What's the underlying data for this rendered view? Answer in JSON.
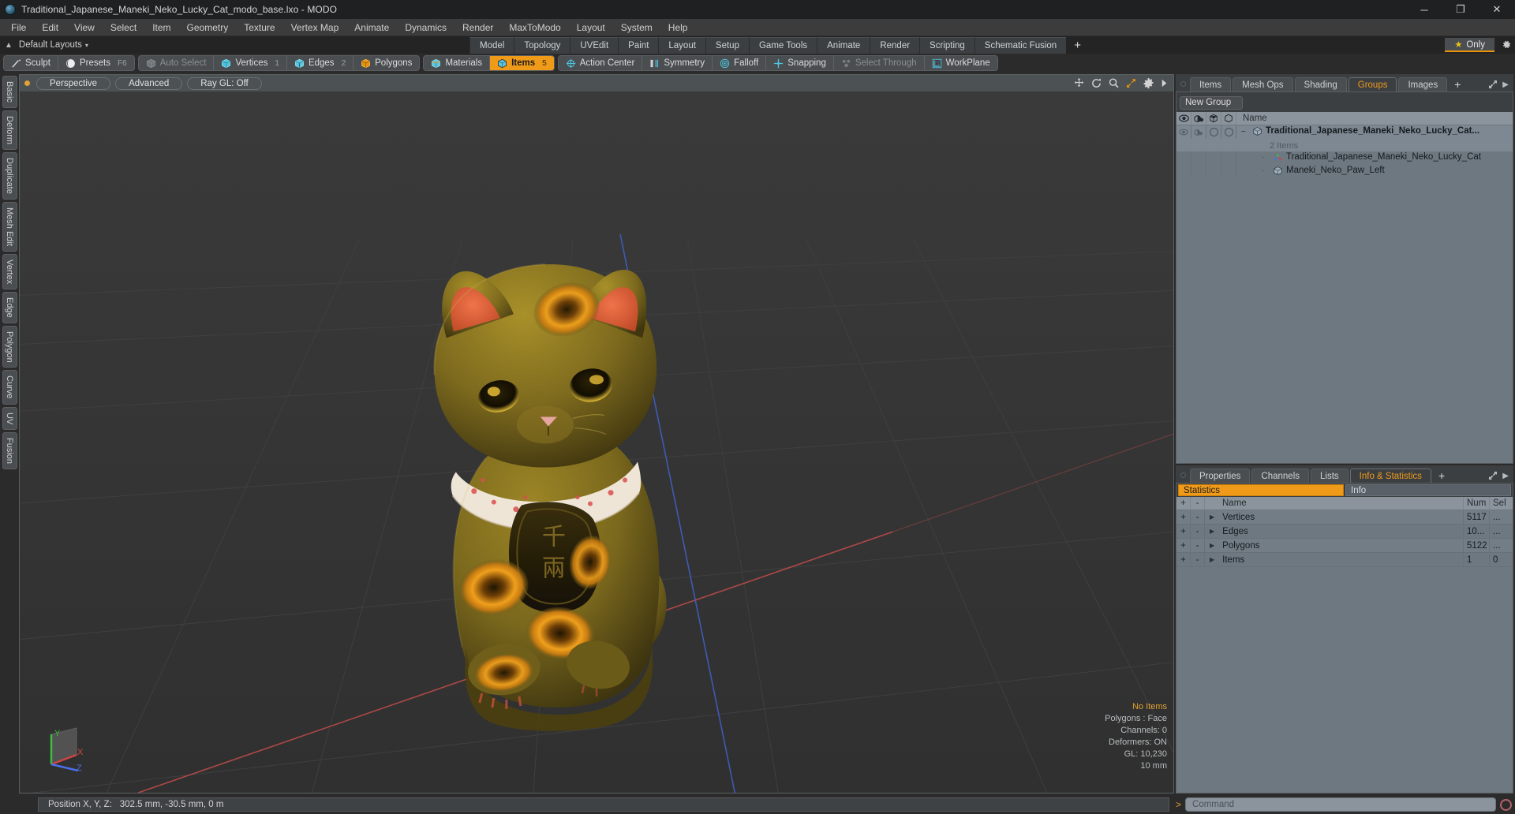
{
  "window": {
    "title": "Traditional_Japanese_Maneki_Neko_Lucky_Cat_modo_base.lxo - MODO",
    "logo_icon": "modo-logo-icon",
    "minimize_label": "─",
    "maximize_label": "❐",
    "close_label": "✕"
  },
  "menu": {
    "items": [
      "File",
      "Edit",
      "View",
      "Select",
      "Item",
      "Geometry",
      "Texture",
      "Vertex Map",
      "Animate",
      "Dynamics",
      "Render",
      "MaxToModo",
      "Layout",
      "System",
      "Help"
    ]
  },
  "layoutbar": {
    "home_icon": "home-arrow-icon",
    "default_layouts": "Default Layouts",
    "caret": "▾",
    "tabs": [
      "Model",
      "Topology",
      "UVEdit",
      "Paint",
      "Layout",
      "Setup",
      "Game Tools",
      "Animate",
      "Render",
      "Scripting",
      "Schematic Fusion"
    ],
    "add_tab": "+",
    "only_label": "Only",
    "only_icon": "star-icon",
    "only_accent": "#e8930c",
    "settings_icon": "gear-icon"
  },
  "toolbar": {
    "group1": [
      {
        "label": "Sculpt",
        "icon": "sculpt-brush-icon",
        "state": "normal",
        "count": ""
      },
      {
        "label": "Presets",
        "icon": "presets-sphere-icon",
        "state": "normal",
        "count": "F6"
      }
    ],
    "group2": [
      {
        "label": "Auto Select",
        "icon": "cube-grey-icon",
        "state": "dim",
        "count": ""
      },
      {
        "label": "Vertices",
        "icon": "cube-vertex-icon",
        "state": "normal",
        "count": "1"
      },
      {
        "label": "Edges",
        "icon": "cube-edge-icon",
        "state": "normal",
        "count": "2"
      },
      {
        "label": "Polygons",
        "icon": "cube-polygon-icon",
        "state": "normal",
        "count": ""
      }
    ],
    "group3": [
      {
        "label": "Materials",
        "icon": "cube-material-icon",
        "state": "normal",
        "count": ""
      },
      {
        "label": "Items",
        "icon": "cube-item-icon",
        "state": "active",
        "count": "5"
      }
    ],
    "group4": [
      {
        "label": "Action Center",
        "icon": "action-center-icon",
        "state": "normal",
        "count": ""
      },
      {
        "label": "Symmetry",
        "icon": "symmetry-icon",
        "state": "normal",
        "count": ""
      },
      {
        "label": "Falloff",
        "icon": "falloff-icon",
        "state": "normal",
        "count": ""
      },
      {
        "label": "Snapping",
        "icon": "snapping-icon",
        "state": "normal",
        "count": ""
      },
      {
        "label": "Select Through",
        "icon": "select-through-icon",
        "state": "dim",
        "count": ""
      },
      {
        "label": "WorkPlane",
        "icon": "workplane-icon",
        "state": "normal",
        "count": ""
      }
    ]
  },
  "left_tabs": [
    "Basic",
    "Deform",
    "Duplicate",
    "Mesh Edit",
    "Vertex",
    "Edge",
    "Polygon",
    "Curve",
    "UV",
    "Fusion"
  ],
  "viewport": {
    "indicator_color": "#e2a133",
    "pills": [
      "Perspective",
      "Advanced",
      "Ray GL: Off"
    ],
    "icons": [
      "move-icon",
      "rotate-icon",
      "zoom-icon",
      "fit-icon",
      "gear-icon",
      "play-arrow-icon"
    ],
    "stats": {
      "no_items": "No Items",
      "polygons": "Polygons : Face",
      "channels": "Channels: 0",
      "deformers": "Deformers: ON",
      "gl": "GL: 10,230",
      "scale": "10 mm"
    },
    "axis": {
      "x": "X",
      "y": "Y",
      "z": "Z",
      "x_color": "#d04545",
      "y_color": "#3fbf3f",
      "z_color": "#4a6fe8"
    },
    "model": {
      "name": "Maneki Neko Lucky Cat",
      "body_color": "#7d6a1e",
      "highlight_color": "#f0a020",
      "ear_inner_color": "#e8603a",
      "collar_color": "#e8e0d0",
      "coin_color": "#4a3c14"
    }
  },
  "right_panel": {
    "tabs": [
      {
        "label": "Items",
        "active": false
      },
      {
        "label": "Mesh Ops",
        "active": false
      },
      {
        "label": "Shading",
        "active": false
      },
      {
        "label": "Groups",
        "active": true
      },
      {
        "label": "Images",
        "active": false
      }
    ],
    "add_tab": "+",
    "expand_icon": "expand-icon",
    "more_icon": "chevron-right-icon",
    "new_group_label": "New Group",
    "tree_columns": [
      "eye-icon",
      "shade-icon",
      "wire-icon",
      "outline-icon",
      "Name"
    ],
    "tree": [
      {
        "name": "Traditional_Japanese_Maneki_Neko_Lucky_Cat...",
        "icon": "group-cube-icon",
        "bold": true,
        "selected": true,
        "sub": "2 Items",
        "indent": 0
      },
      {
        "name": "Traditional_Japanese_Maneki_Neko_Lucky_Cat",
        "icon": "locator-axis-icon",
        "bold": false,
        "selected": false,
        "sub": "",
        "indent": 1
      },
      {
        "name": "Maneki_Neko_Paw_Left",
        "icon": "mesh-cube-icon",
        "bold": false,
        "selected": false,
        "sub": "",
        "indent": 1
      }
    ]
  },
  "bottom_panel": {
    "tabs": [
      {
        "label": "Properties",
        "active": false
      },
      {
        "label": "Channels",
        "active": false
      },
      {
        "label": "Lists",
        "active": false
      },
      {
        "label": "Info & Statistics",
        "active": true
      }
    ],
    "add_tab": "+",
    "subtabs": [
      {
        "label": "Statistics",
        "active": true
      },
      {
        "label": "Info",
        "active": false
      }
    ],
    "columns": {
      "plus": "+",
      "minus": "-",
      "name": "Name",
      "num": "Num",
      "sel": "Sel"
    },
    "rows": [
      {
        "plus": "+",
        "minus": "-",
        "name": "Vertices",
        "num": "5117",
        "sel": "..."
      },
      {
        "plus": "+",
        "minus": "-",
        "name": "Edges",
        "num": "10...",
        "sel": "..."
      },
      {
        "plus": "+",
        "minus": "-",
        "name": "Polygons",
        "num": "5122",
        "sel": "..."
      },
      {
        "plus": "+",
        "minus": "-",
        "name": "Items",
        "num": "1",
        "sel": "0"
      }
    ]
  },
  "statusbar": {
    "position_label": "Position X, Y, Z:",
    "position_value": "302.5 mm, -30.5 mm, 0 m",
    "command_prompt": ">",
    "command_placeholder": "Command",
    "record_icon": "record-icon"
  }
}
